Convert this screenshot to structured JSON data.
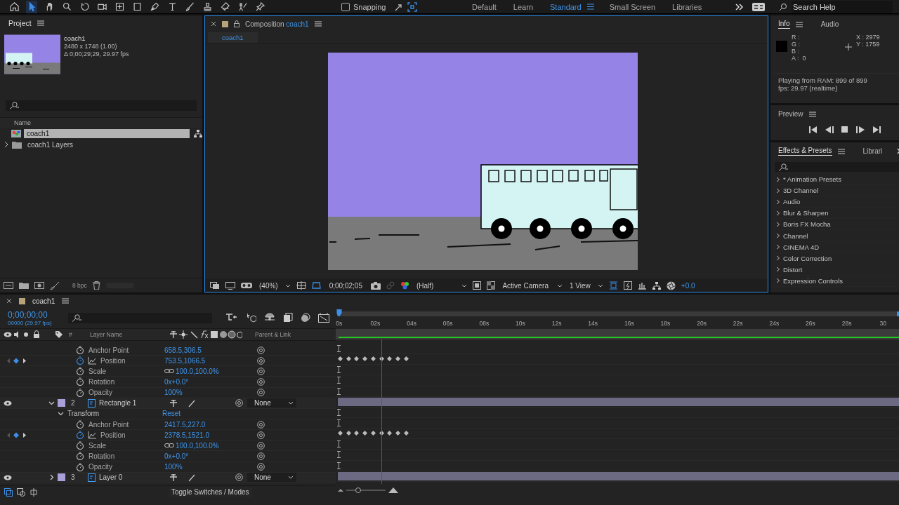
{
  "toolbar": {
    "tools": [
      {
        "selected": false
      },
      {
        "selected": true
      },
      {
        "selected": false
      },
      {
        "selected": false
      },
      {
        "selected": false
      },
      {
        "selected": false
      },
      {
        "selected": false
      },
      {
        "selected": false
      },
      {
        "selected": false
      },
      {
        "selected": false
      },
      {
        "selected": false
      },
      {
        "selected": false
      },
      {
        "selected": false
      },
      {
        "selected": false
      },
      {
        "selected": false
      }
    ],
    "snapping": {
      "label": "Snapping",
      "checked": false
    },
    "workspaces": [
      {
        "label": "Default",
        "selected": false
      },
      {
        "label": "Learn",
        "selected": false
      },
      {
        "label": "Standard",
        "selected": true
      },
      {
        "label": "Small Screen",
        "selected": false
      },
      {
        "label": "Libraries",
        "selected": false
      }
    ],
    "search": {
      "placeholder": "Search Help"
    }
  },
  "project": {
    "title": "Project",
    "preview": {
      "name": "coach1",
      "size": "2480 x 1748 (1.00)",
      "duration": "Δ 0;00;29;29, 29.97 fps"
    },
    "column": "Name",
    "items": [
      {
        "kind": "composition",
        "name": "coach1",
        "selected": true
      },
      {
        "kind": "folder",
        "name": "coach1 Layers",
        "selected": false
      }
    ],
    "bit_depth": "8 bpc"
  },
  "composition": {
    "tab": {
      "label": "Composition",
      "name": "coach1"
    },
    "breadcrumb": "coach1",
    "zoom": "(40%)",
    "timecode": "0;00;02;05",
    "resolution": "(Half)",
    "camera": "Active Camera",
    "views": "1 View",
    "exposure": "+0.0"
  },
  "info": {
    "tabs": [
      {
        "label": "Info",
        "selected": true
      },
      {
        "label": "Audio",
        "selected": false
      }
    ],
    "channels": [
      "R :",
      "G :",
      "B :",
      "A :  0"
    ],
    "x": "X : 2979",
    "y": "Y : 1759",
    "status": [
      "Playing from RAM: 899 of 899",
      "fps: 29.97 (realtime)"
    ]
  },
  "preview": {
    "title": "Preview"
  },
  "effects": {
    "tabs": [
      {
        "label": "Effects & Presets",
        "selected": true
      },
      {
        "label": "Librari",
        "selected": false
      }
    ],
    "categories": [
      "* Animation Presets",
      "3D Channel",
      "Audio",
      "Blur & Sharpen",
      "Boris FX Mocha",
      "Channel",
      "CINEMA 4D",
      "Color Correction",
      "Distort",
      "Expression Controls"
    ]
  },
  "timeline": {
    "tab": "coach1",
    "timecode": "0;00;00;00",
    "frame_info": "00000 (29.97 fps)",
    "columns": {
      "number": "#",
      "layer_name": "Layer Name",
      "parent": "Parent & Link"
    },
    "ruler": [
      "0s",
      "02s",
      "04s",
      "06s",
      "08s",
      "10s",
      "12s",
      "14s",
      "16s",
      "18s",
      "20s",
      "22s",
      "24s",
      "26s",
      "28s",
      "30"
    ],
    "current_time": {
      "level": 0
    },
    "zoom_slider": {
      "level": 0.3
    },
    "cursor_line": {
      "level": 0.078
    },
    "rows": [
      {
        "kind": "property",
        "name": "Anchor Point",
        "value": "658.5,306.5",
        "keyframed": false,
        "linked": false
      },
      {
        "kind": "property",
        "name": "Position",
        "value": "753.5,1066.5",
        "keyframed": true,
        "linked": false
      },
      {
        "kind": "property",
        "name": "Scale",
        "value": "100.0,100.0%",
        "keyframed": false,
        "linked": true
      },
      {
        "kind": "property",
        "name": "Rotation",
        "value": "0x+0.0°",
        "keyframed": false,
        "linked": false
      },
      {
        "kind": "property",
        "name": "Opacity",
        "value": "100%",
        "keyframed": false,
        "linked": false
      },
      {
        "kind": "layer",
        "number": "2",
        "name": "Rectangle 1",
        "color": "#a9a0d8",
        "expanded": true,
        "visible": true,
        "parent": "None"
      },
      {
        "kind": "group",
        "name": "Transform",
        "value": "Reset",
        "expanded": true
      },
      {
        "kind": "property",
        "name": "Anchor Point",
        "value": "2417.5,227.0",
        "keyframed": false,
        "linked": false
      },
      {
        "kind": "property",
        "name": "Position",
        "value": "2378.5,1521.0",
        "keyframed": true,
        "linked": false
      },
      {
        "kind": "property",
        "name": "Scale",
        "value": "100.0,100.0%",
        "keyframed": false,
        "linked": true
      },
      {
        "kind": "property",
        "name": "Rotation",
        "value": "0x+0.0°",
        "keyframed": false,
        "linked": false
      },
      {
        "kind": "property",
        "name": "Opacity",
        "value": "100%",
        "keyframed": false,
        "linked": false
      },
      {
        "kind": "layer",
        "number": "3",
        "name": "Layer 0",
        "color": "#a9a0d8",
        "expanded": false,
        "visible": true,
        "parent": "None"
      }
    ],
    "footer": "Toggle Switches / Modes"
  }
}
